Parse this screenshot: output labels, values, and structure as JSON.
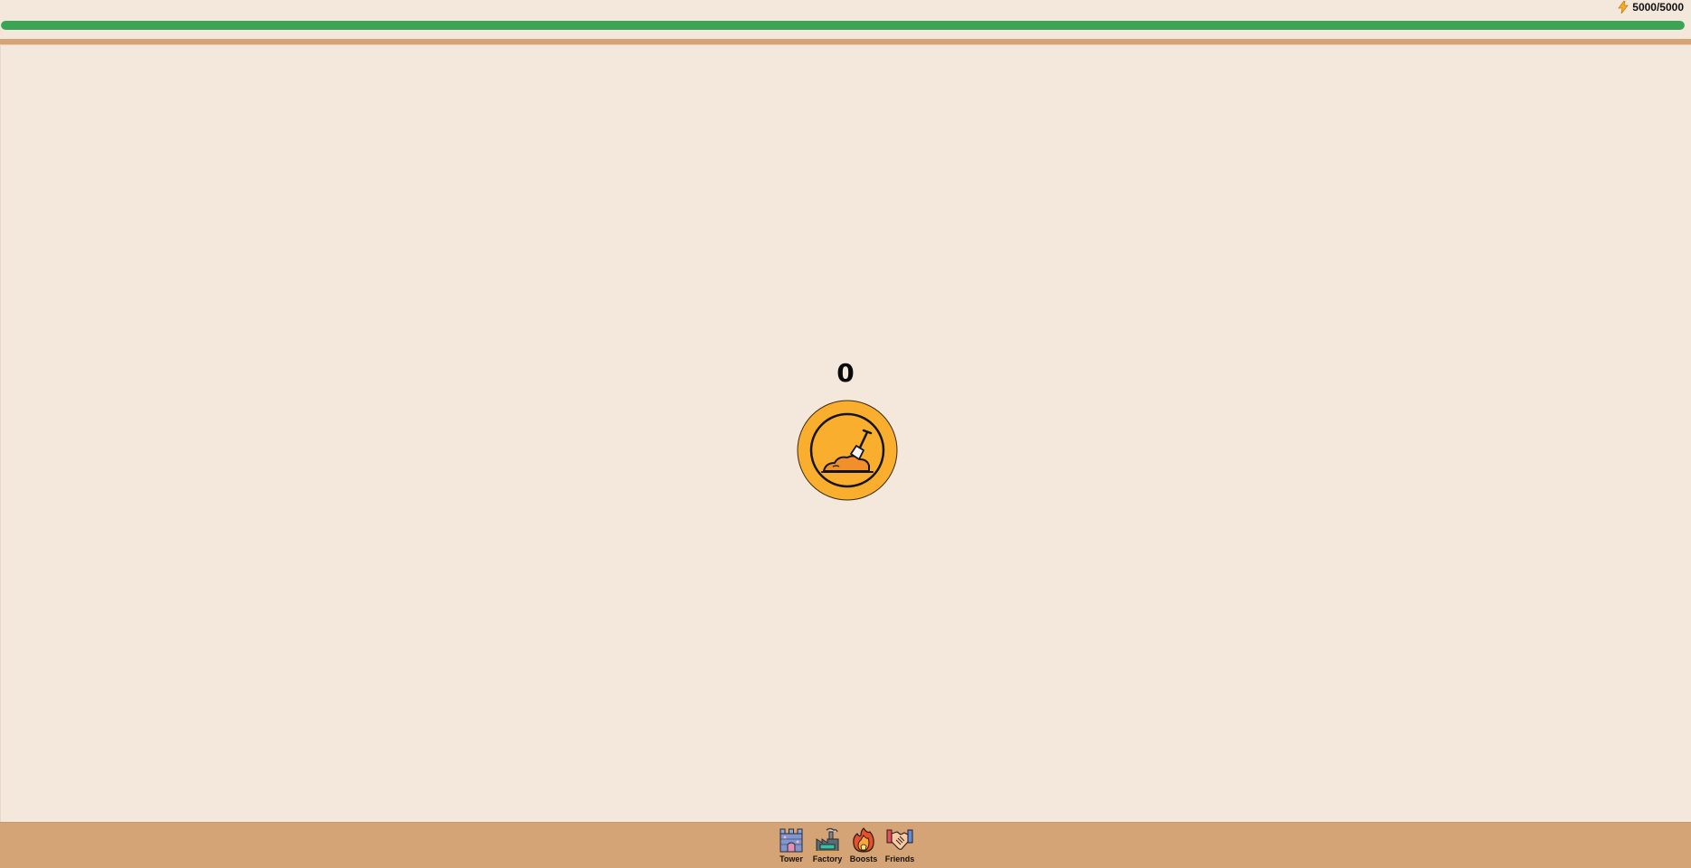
{
  "energy": {
    "label": "5000/5000",
    "current": 5000,
    "max": 5000,
    "fill_fraction": 1.0,
    "icon": "lightning-icon",
    "bar_color": "#3aa655"
  },
  "score": {
    "value": "0"
  },
  "tap_button": {
    "icon": "shovel-dirt-icon",
    "color": "#f9ae2d"
  },
  "nav": {
    "items": [
      {
        "label": "Tower",
        "icon": "tower-icon"
      },
      {
        "label": "Factory",
        "icon": "factory-icon"
      },
      {
        "label": "Boosts",
        "icon": "fire-icon"
      },
      {
        "label": "Friends",
        "icon": "handshake-icon"
      }
    ]
  },
  "colors": {
    "background": "#f4e8dc",
    "accent_brown": "#d4a476",
    "coin_orange": "#f9ae2d"
  }
}
